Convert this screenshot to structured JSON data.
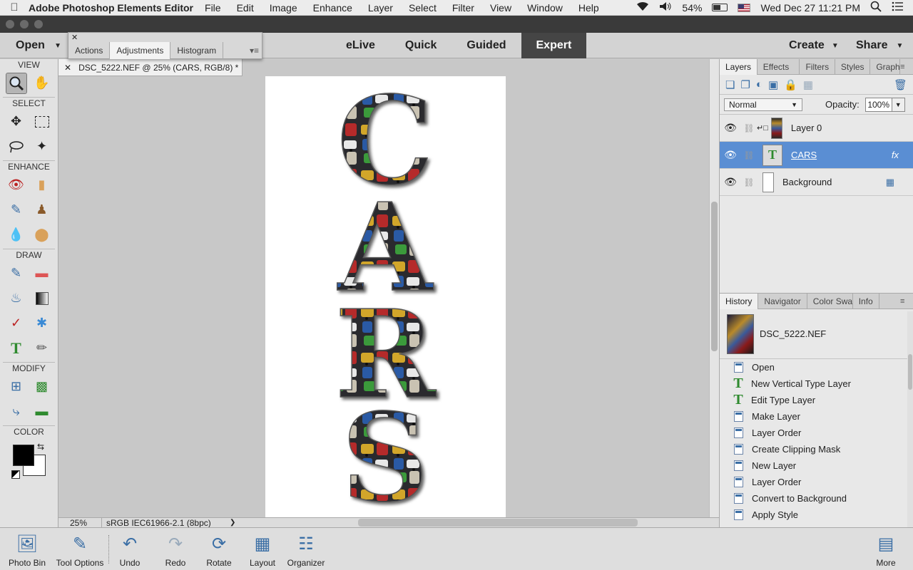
{
  "menubar": {
    "app_name": "Adobe Photoshop Elements Editor",
    "menus": [
      "File",
      "Edit",
      "Image",
      "Enhance",
      "Layer",
      "Select",
      "Filter",
      "View",
      "Window",
      "Help"
    ],
    "battery": "54%",
    "datetime": "Wed Dec 27  11:21 PM"
  },
  "modebar": {
    "open_label": "Open",
    "modes": [
      "eLive",
      "Quick",
      "Guided",
      "Expert"
    ],
    "active_mode": "Expert",
    "create_label": "Create",
    "share_label": "Share"
  },
  "float_panel": {
    "tabs": [
      "Actions",
      "Adjustments",
      "Histogram"
    ],
    "active_tab": "Adjustments"
  },
  "toolbox": {
    "sections": [
      "VIEW",
      "SELECT",
      "ENHANCE",
      "DRAW",
      "MODIFY",
      "COLOR"
    ],
    "foreground_color": "#000000",
    "background_color": "#ffffff"
  },
  "document": {
    "tab_title": "DSC_5222.NEF @ 25% (CARS, RGB/8) *",
    "canvas_text": [
      "C",
      "A",
      "R",
      "S"
    ]
  },
  "statusbar": {
    "zoom": "25%",
    "profile": "sRGB IEC61966-2.1 (8bpc)"
  },
  "layers_panel": {
    "tabs": [
      "Layers",
      "Effects",
      "Filters",
      "Styles",
      "Graphi"
    ],
    "active_tab": "Layers",
    "blend_mode": "Normal",
    "opacity_label": "Opacity:",
    "opacity": "100%",
    "layers": [
      {
        "name": "Layer 0",
        "selected": false
      },
      {
        "name": "CARS",
        "selected": true,
        "fx": "fx"
      },
      {
        "name": "Background",
        "selected": false
      }
    ]
  },
  "history_panel": {
    "tabs": [
      "History",
      "Navigator",
      "Color Swa",
      "Info"
    ],
    "active_tab": "History",
    "snapshot_name": "DSC_5222.NEF",
    "items": [
      {
        "label": "Open",
        "icon": "doc"
      },
      {
        "label": "New Vertical Type Layer",
        "icon": "type"
      },
      {
        "label": "Edit Type Layer",
        "icon": "type"
      },
      {
        "label": "Make Layer",
        "icon": "doc"
      },
      {
        "label": "Layer Order",
        "icon": "doc"
      },
      {
        "label": "Create Clipping Mask",
        "icon": "doc"
      },
      {
        "label": "New Layer",
        "icon": "doc"
      },
      {
        "label": "Layer Order",
        "icon": "doc"
      },
      {
        "label": "Convert to Background",
        "icon": "doc"
      },
      {
        "label": "Apply Style",
        "icon": "doc"
      }
    ]
  },
  "bottombar": {
    "photo_bin": "Photo Bin",
    "tool_options": "Tool Options",
    "undo": "Undo",
    "redo": "Redo",
    "rotate": "Rotate",
    "layout": "Layout",
    "organizer": "Organizer",
    "more": "More"
  }
}
